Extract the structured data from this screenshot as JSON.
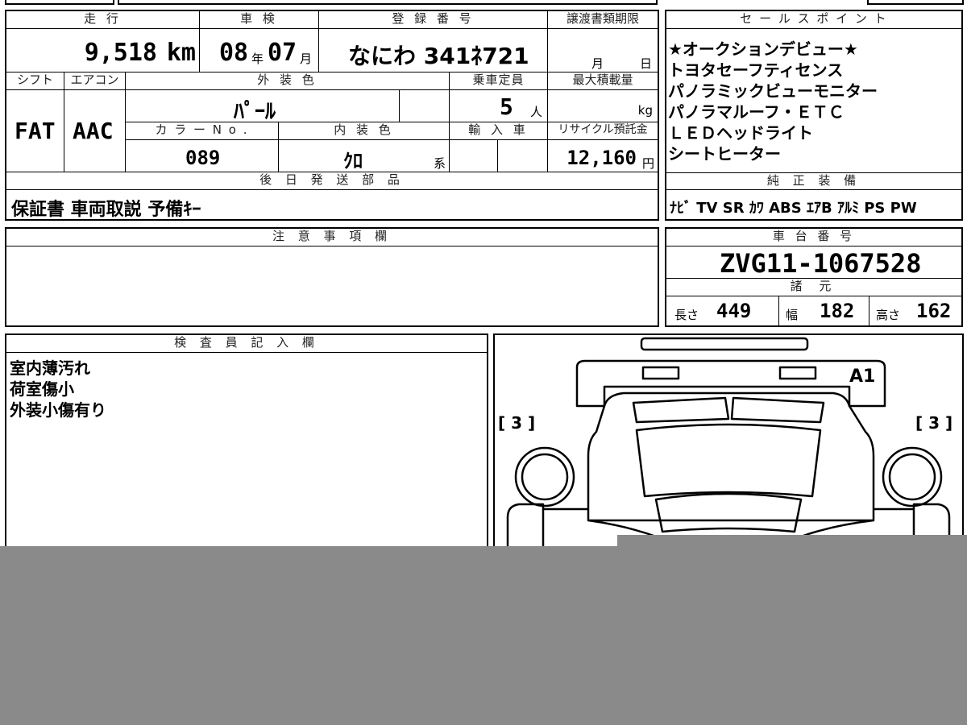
{
  "vehicle": {
    "mileage_header": "走 行",
    "mileage_value": "9,518",
    "mileage_unit": "km",
    "inspection_header": "車 検",
    "inspection_year": "08",
    "inspection_year_unit": "年",
    "inspection_month": "07",
    "inspection_month_unit": "月",
    "registration_header": "登 録 番 号",
    "registration_value": "なにわ 341ﾈ721",
    "transfer_header": "譲渡書類期限",
    "transfer_month_unit": "月",
    "transfer_day_unit": "日",
    "shift_header": "シフト",
    "shift_value": "FAT",
    "aircon_header": "エアコン",
    "aircon_value": "AAC",
    "exterior_header": "外 装 色",
    "exterior_value": "ﾊﾟｰﾙ",
    "capacity_header": "乗車定員",
    "capacity_value": "5",
    "capacity_unit": "人",
    "load_header": "最大積載量",
    "load_unit": "kg",
    "color_no_header": "カ ラ ー N o .",
    "color_no_value": "089",
    "interior_header": "内 装 色",
    "interior_value": "ｸﾛ",
    "interior_unit": "系",
    "import_header": "輸 入 車",
    "recycle_header": "リサイクル預託金",
    "recycle_value": "12,160",
    "recycle_unit": "円",
    "later_parts_header": "後 日 発 送 部 品",
    "later_parts_value": "保証書 車両取説 予備ｷｰ"
  },
  "sales_points": {
    "header": "セ ー ル ス ポ イ ン ト",
    "items": [
      "★オークションデビュー★",
      "トヨタセーフティセンス",
      "パノラミックビューモニター",
      "パノラマルーフ・ＥＴＣ",
      "ＬＥＤヘッドライト",
      "シートヒーター"
    ]
  },
  "equipment": {
    "header": "純 正 装 備",
    "value": "ﾅﾋﾞ TV SR ｶﾜ ABS ｴｱB ｱﾙﾐ PS PW"
  },
  "notes": {
    "header": "注 意 事 項 欄",
    "value": ""
  },
  "chassis": {
    "header": "車 台 番 号",
    "value": "ZVG11-1067528",
    "spec_header": "諸 元",
    "length_label": "長さ",
    "length_value": "449",
    "width_label": "幅",
    "width_value": "182",
    "height_label": "高さ",
    "height_value": "162"
  },
  "inspector": {
    "header": "検 査 員 記 入 欄",
    "lines": [
      "室内薄汚れ",
      "荷室傷小",
      "外装小傷有り"
    ]
  },
  "diagram": {
    "mark_a1": "A1",
    "left_bracket": "[ 3 ]",
    "right_bracket": "[ 3 ]"
  }
}
